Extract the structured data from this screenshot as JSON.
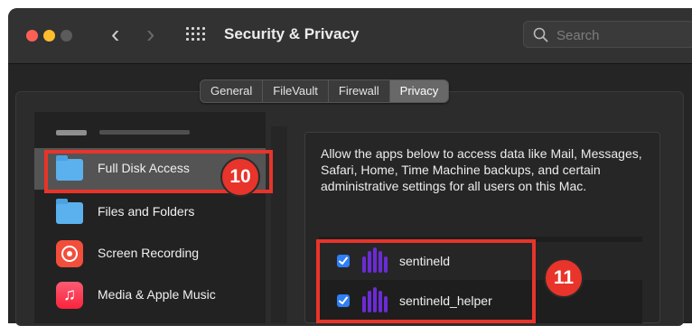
{
  "window": {
    "title": "Security & Privacy",
    "search_placeholder": "Search"
  },
  "tabs": [
    "General",
    "FileVault",
    "Firewall",
    "Privacy"
  ],
  "active_tab": "Privacy",
  "sidebar": {
    "items": [
      {
        "label": "Full Disk Access",
        "icon": "folder-icon"
      },
      {
        "label": "Files and Folders",
        "icon": "folder-icon"
      },
      {
        "label": "Screen Recording",
        "icon": "screen-recording-icon"
      },
      {
        "label": "Media & Apple Music",
        "icon": "music-icon"
      }
    ],
    "selected": "Full Disk Access"
  },
  "description": "Allow the apps below to access data like Mail, Messages, Safari, Home, Time Machine backups, and certain administrative settings for all users on this Mac.",
  "apps": [
    {
      "name": "sentineld",
      "checked": true
    },
    {
      "name": "sentineld_helper",
      "checked": true
    }
  ],
  "callouts": {
    "step_a": "10",
    "step_b": "11"
  },
  "colors": {
    "callout": "#e8342a",
    "checkbox": "#2f7ff5",
    "sentinel_logo": "#6b2bd6"
  }
}
